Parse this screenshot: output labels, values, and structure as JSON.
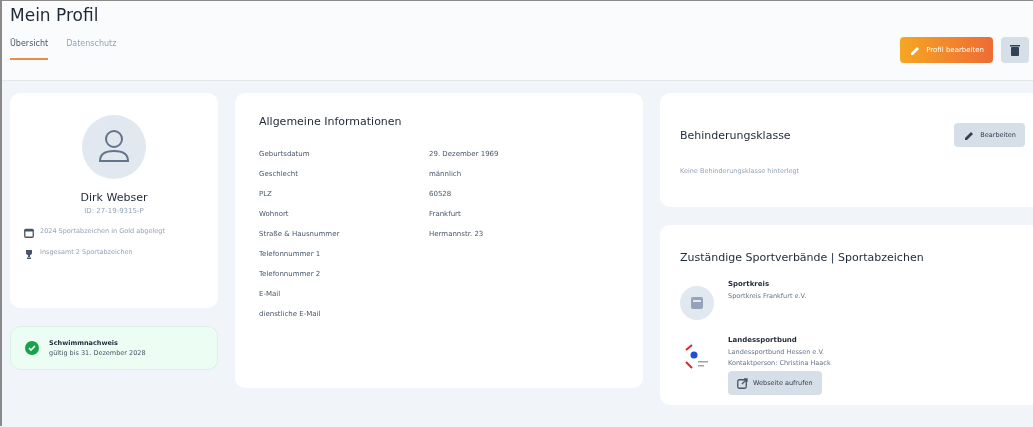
{
  "page": {
    "title": "Mein Profil"
  },
  "tabs": [
    {
      "label": "Übersicht",
      "selected": true
    },
    {
      "label": "Datenschutz",
      "selected": false
    }
  ],
  "actions": [
    {
      "kind": "primary",
      "label": "Profil bearbeiten"
    },
    {
      "kind": "delete"
    }
  ],
  "profile": {
    "name": "Dirk Webser",
    "id": "ID: 27-19-9315-P",
    "facts": [
      {
        "kind": "calendar",
        "text": "2024 Sportabzeichen in Gold abgelegt"
      },
      {
        "kind": "trophy",
        "text": "Insgesamt 2 Sportabzeichen"
      }
    ]
  },
  "swim": {
    "title": "Schwimmnachweis",
    "text": "gültig bis 31. Dezember 2028",
    "valid": true
  },
  "general": {
    "title": "Allgemeine Informationen",
    "rows": [
      {
        "label": "Geburtsdatum",
        "value": "29. Dezember 1969"
      },
      {
        "label": "Geschlecht",
        "value": "männlich"
      },
      {
        "label": "PLZ",
        "value": "60528"
      },
      {
        "label": "Wohnort",
        "value": "Frankfurt"
      },
      {
        "label": "Straße & Hausnummer",
        "value": "Hermannstr. 23"
      },
      {
        "label": "Telefonnummer 1"
      },
      {
        "label": "Telefonnummer 2"
      },
      {
        "label": "E-Mail"
      },
      {
        "label": "dienstliche E-Mail"
      }
    ]
  },
  "disability": {
    "title": "Behinderungsklasse",
    "button": "Bearbeiten",
    "text": "Keine Behinderungsklasse hinterlegt"
  },
  "associations": {
    "title": "Zuständige Sportverbände | Sportabzeichen",
    "items": [
      {
        "kind": "placeholder",
        "title": "Sportkreis",
        "lines": [
          "Sportkreis Frankfurt e.V."
        ]
      },
      {
        "kind": "logo",
        "title": "Landessportbund",
        "lines": [
          "Landessportbund Hessen e.V.",
          "Kontaktperson: Christina Haack"
        ],
        "link": "Webseite aufrufen"
      }
    ]
  }
}
